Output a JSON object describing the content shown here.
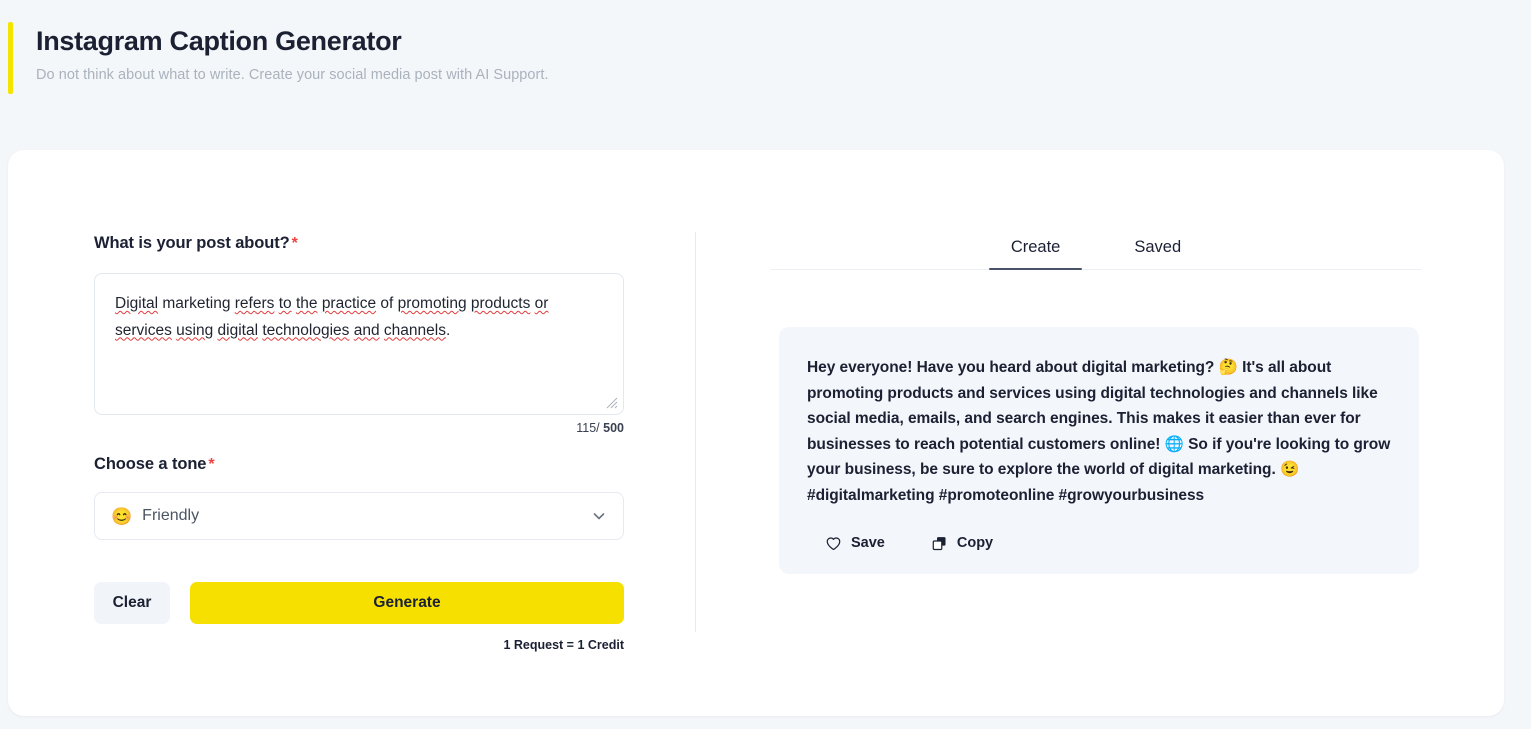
{
  "header": {
    "title": "Instagram Caption Generator",
    "subtitle": "Do not think about what to write. Create your social media post with AI Support.",
    "accent_color": "#f5e400"
  },
  "form": {
    "post_label": "What is your post about?",
    "required_marker": "*",
    "textarea": {
      "value": "Digital marketing refers to the practice of promoting products or services using digital technologies and channels.",
      "placeholder": "",
      "char_count": "115/",
      "char_limit": "500"
    },
    "tone_label": "Choose a tone",
    "tone": {
      "emoji": "😊",
      "emoji_name": "smiling-face-with-smiling-eyes",
      "value": "Friendly",
      "chevron_icon": "chevron-down-icon"
    },
    "clear_label": "Clear",
    "generate_label": "Generate",
    "credit_note": "1 Request = 1 Credit",
    "generate_color": "#f5e000",
    "clear_color": "#f1f5f9"
  },
  "output": {
    "tabs": [
      {
        "label": "Create",
        "active": true
      },
      {
        "label": "Saved",
        "active": false
      }
    ],
    "result": {
      "text": "Hey everyone! Have you heard about digital marketing? 🤔 It's all about promoting products and services using digital technologies and channels like social media, emails, and search engines. This makes it easier than ever for businesses to reach potential customers online! 🌐 So if you're looking to grow your business, be sure to explore the world of digital marketing. 😉 #digitalmarketing #promoteonline #growyourbusiness",
      "actions": [
        {
          "label": "Save",
          "icon": "heart-icon"
        },
        {
          "label": "Copy",
          "icon": "copy-icon"
        }
      ]
    }
  }
}
